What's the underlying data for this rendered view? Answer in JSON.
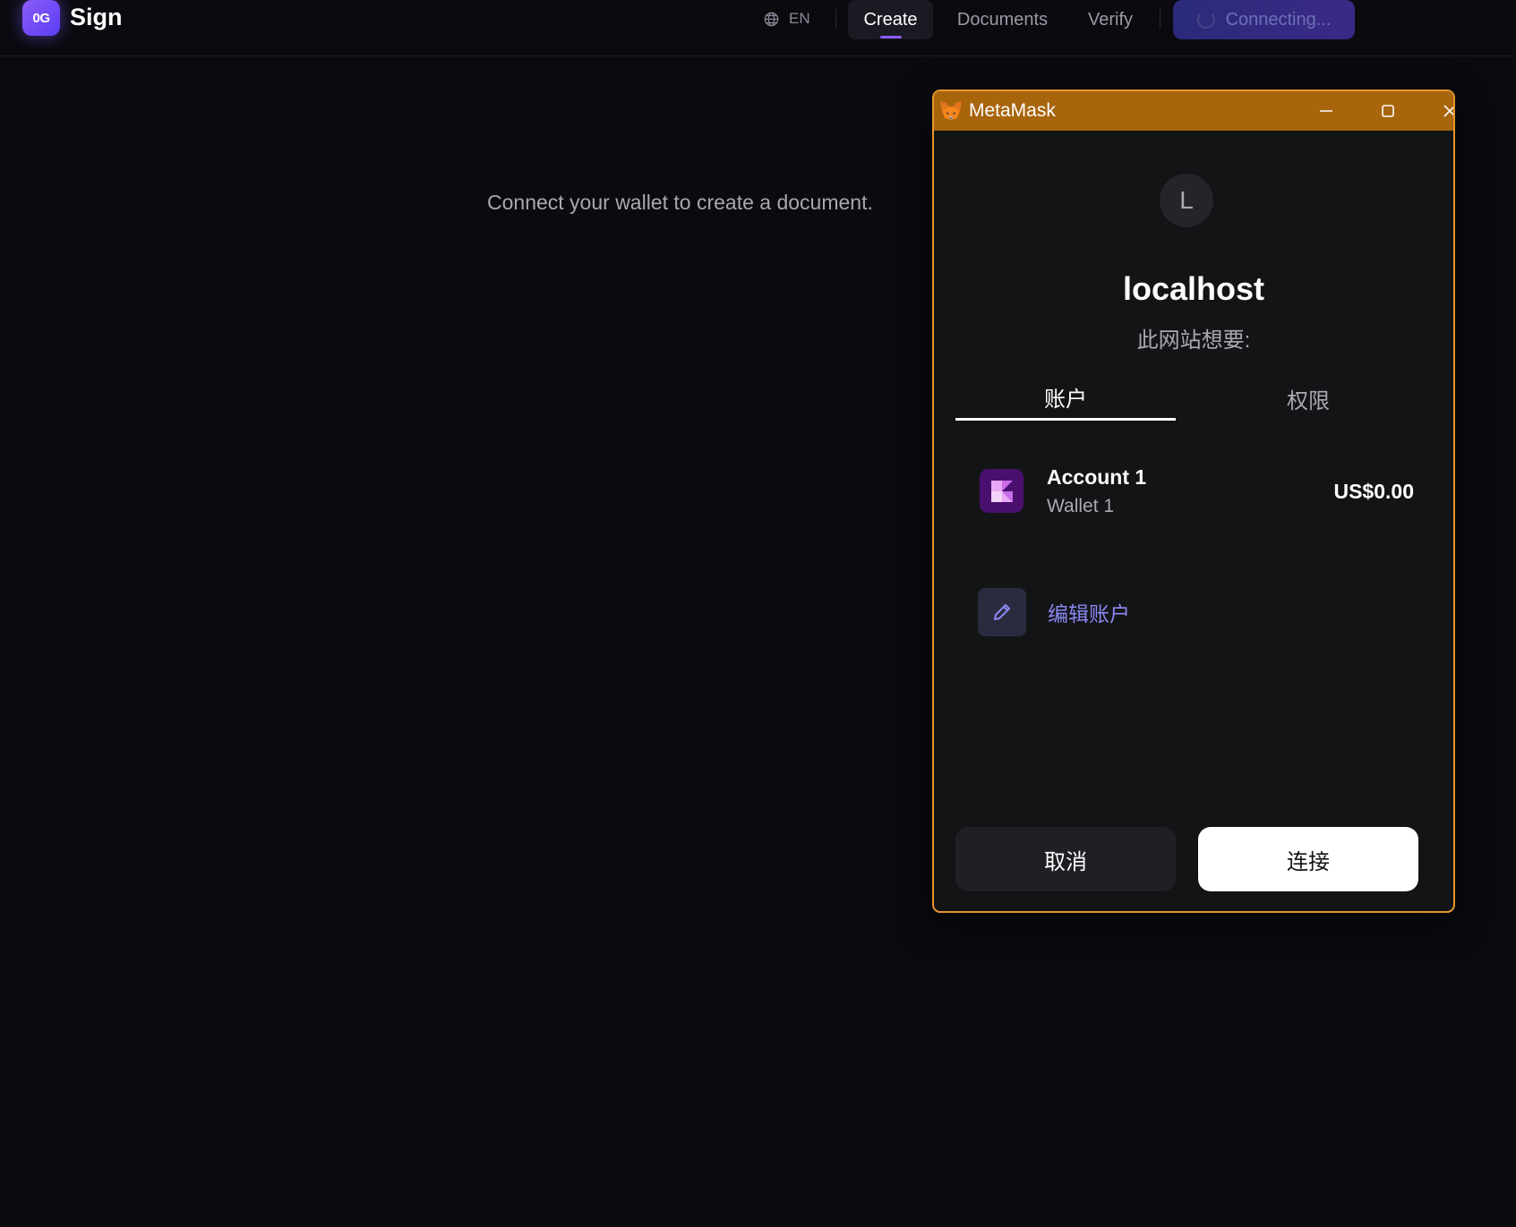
{
  "app": {
    "logo_text": "0G",
    "title": "Sign"
  },
  "nav": {
    "language": "EN",
    "tabs": [
      {
        "label": "Create",
        "active": true
      },
      {
        "label": "Documents",
        "active": false
      },
      {
        "label": "Verify",
        "active": false
      }
    ],
    "connect_status": "Connecting..."
  },
  "main": {
    "message": "Connect your wallet to create a document."
  },
  "metamask": {
    "window_title": "MetaMask",
    "site_initial": "L",
    "site_name": "localhost",
    "site_wants": "此网站想要:",
    "tabs": [
      {
        "label": "账户",
        "active": true
      },
      {
        "label": "权限",
        "active": false
      }
    ],
    "account": {
      "name": "Account 1",
      "wallet": "Wallet 1",
      "balance": "US$0.00"
    },
    "edit_accounts_label": "编辑账户",
    "cancel_label": "取消",
    "connect_label": "连接"
  },
  "colors": {
    "background": "#0a0a0f",
    "accent_purple": "#8b5cf6",
    "metamask_orange": "#e8962a",
    "metamask_titlebar": "#a8650c",
    "edit_link": "#8a88f0"
  }
}
